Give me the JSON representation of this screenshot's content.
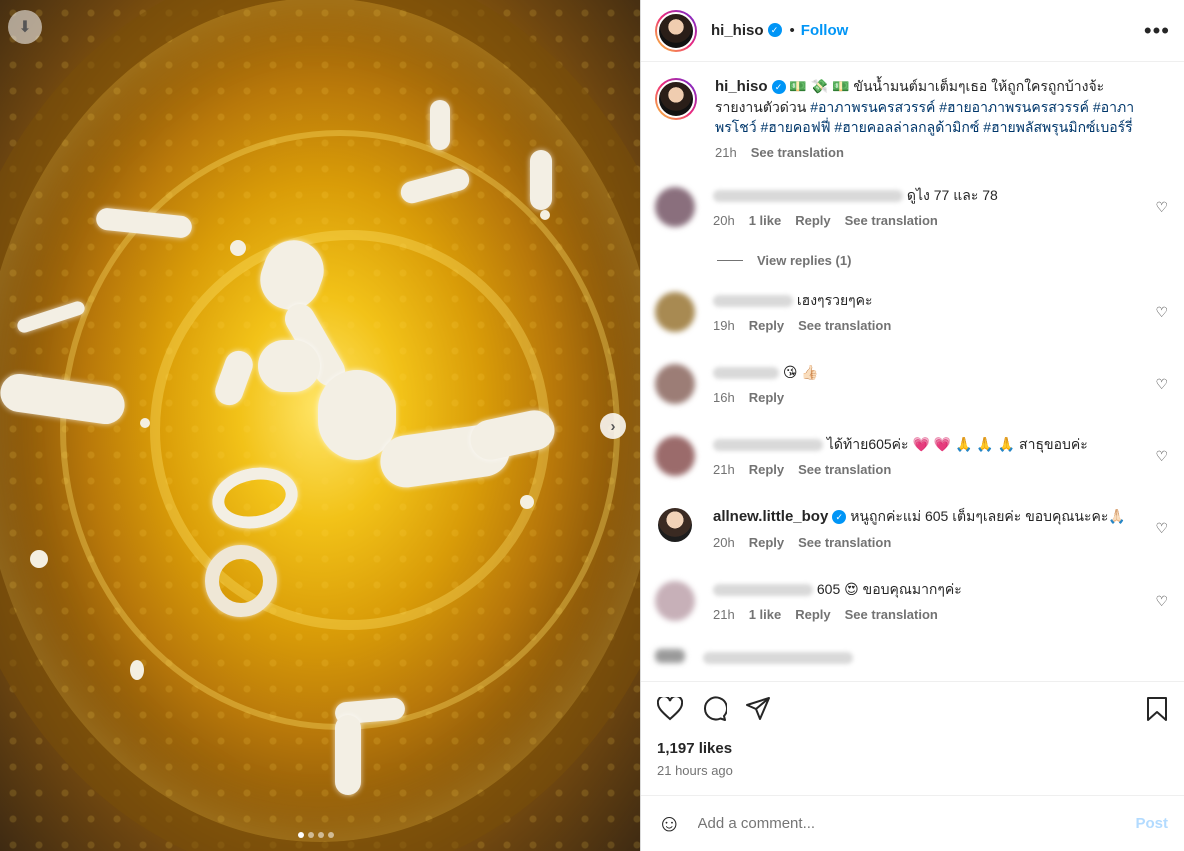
{
  "header": {
    "username": "hi_hiso",
    "separator": "•",
    "follow_label": "Follow",
    "more_icon": "more-horizontal-icon"
  },
  "caption": {
    "username": "hi_hiso",
    "emojis": "💵 💸 💵",
    "text": "ขันน้ำมนต์มาเต็มๆเธอ ให้ถูกใครถูกบ้างจ้ะ รายงานตัวด่วน",
    "hashtags": "#อาภาพรนครสวรรค์ #ฮายอาภาพรนครสวรรค์ #อาภาพรโชว์ #ฮายคอฟฟี่ #ฮายคอลล่าลกลูด้ามิกซ์ #ฮายพลัสพรุนมิกซ์เบอร์รี่",
    "time": "21h",
    "see_translation": "See translation"
  },
  "comments": [
    {
      "text": "ดูไง 77 และ 78",
      "time": "20h",
      "likes": "1 like",
      "reply": "Reply",
      "see_translation": "See translation"
    },
    {
      "text": "เฮงๆรวยๆคะ",
      "time": "19h",
      "reply": "Reply",
      "see_translation": "See translation"
    },
    {
      "text": "😘 👍🏻",
      "time": "16h",
      "reply": "Reply"
    },
    {
      "text": "ได้ท้าย605ค่ะ 💗 💗 🙏 🙏 🙏 สาธุขอบค่ะ",
      "time": "21h",
      "reply": "Reply",
      "see_translation": "See translation"
    },
    {
      "username": "allnew.little_boy",
      "text": "หนูถูกค่ะแม่ 605 เต็มๆเลยค่ะ ขอบคุณนะคะ🙏🏻",
      "time": "20h",
      "reply": "Reply",
      "see_translation": "See translation"
    },
    {
      "text": "605 😍 ขอบคุณมากๆค่ะ",
      "time": "21h",
      "likes": "1 like",
      "reply": "Reply",
      "see_translation": "See translation"
    }
  ],
  "view_replies": "View replies (1)",
  "actions": {
    "likes": "1,197 likes",
    "time_ago": "21 hours ago"
  },
  "add_comment": {
    "placeholder": "Add a comment...",
    "post_label": "Post"
  },
  "colors": {
    "accent": "#0095f6",
    "hashtag": "#00376b",
    "muted": "#737373",
    "post_disabled": "#b3dbff"
  }
}
